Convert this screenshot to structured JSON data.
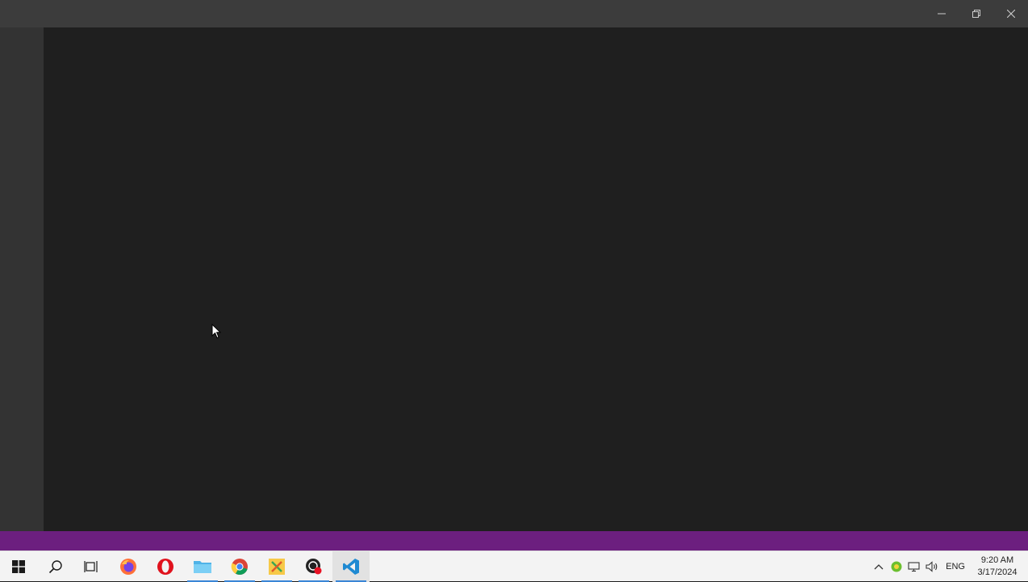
{
  "window": {
    "controls": {
      "minimize": "minimize-icon",
      "restore": "restore-icon",
      "close": "close-icon"
    }
  },
  "colors": {
    "titlebar": "#3c3c3c",
    "activitybar": "#333333",
    "editor": "#1f1f1f",
    "statusbar": "#6c1f7f",
    "taskbar": "#f3f3f3"
  },
  "taskbar": {
    "apps": [
      {
        "name": "start",
        "icon": "windows-logo-icon"
      },
      {
        "name": "search",
        "icon": "search-icon"
      },
      {
        "name": "task-view",
        "icon": "task-view-icon"
      },
      {
        "name": "firefox",
        "icon": "firefox-icon"
      },
      {
        "name": "opera",
        "icon": "opera-icon"
      },
      {
        "name": "file-explorer",
        "icon": "folder-icon",
        "running": true
      },
      {
        "name": "chrome",
        "icon": "chrome-icon",
        "running": true
      },
      {
        "name": "app-x",
        "icon": "app-x-icon",
        "running": true
      },
      {
        "name": "obs",
        "icon": "record-icon",
        "running": true
      },
      {
        "name": "vscode",
        "icon": "vscode-icon",
        "running": true,
        "active": true
      }
    ],
    "tray": {
      "language": "ENG",
      "time": "9:20 AM",
      "date": "3/17/2024"
    }
  }
}
